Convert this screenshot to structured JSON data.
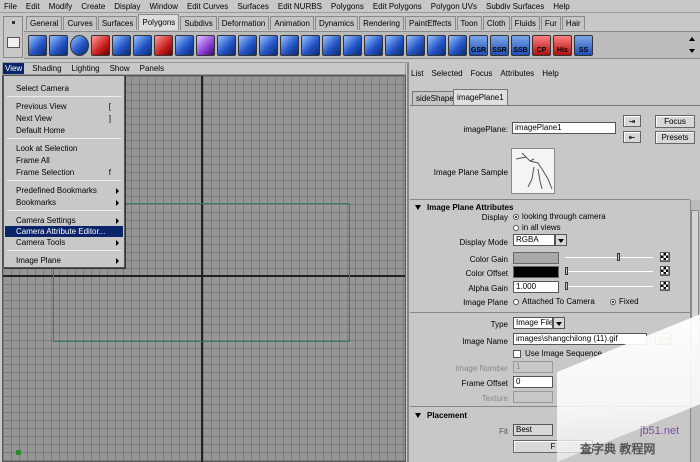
{
  "menubar": [
    "File",
    "Edit",
    "Modify",
    "Create",
    "Display",
    "Window",
    "Edit Curves",
    "Surfaces",
    "Edit NURBS",
    "Polygons",
    "Edit Polygons",
    "Polygon UVs",
    "Subdiv Surfaces",
    "Help"
  ],
  "shelf_tabs": [
    "General",
    "Curves",
    "Surfaces",
    "Polygons",
    "Subdivs",
    "Deformation",
    "Animation",
    "Dynamics",
    "Rendering",
    "PaintEffects",
    "Toon",
    "Cloth",
    "Fluids",
    "Fur",
    "Hair"
  ],
  "shelf_active_tab": "Polygons",
  "shelf_labels": [
    "GSR",
    "SSR",
    "SSB",
    "CP",
    "His",
    "SS"
  ],
  "viewport_menu": [
    "View",
    "Shading",
    "Lighting",
    "Show",
    "Panels"
  ],
  "view_menu": {
    "items": [
      {
        "label": "Select Camera",
        "shortcut": "",
        "submenu": false
      },
      {
        "label": "Previous View",
        "shortcut": "[",
        "submenu": false
      },
      {
        "label": "Next View",
        "shortcut": "]",
        "submenu": false
      },
      {
        "label": "Default Home",
        "shortcut": "",
        "submenu": false
      },
      {
        "label": "Look at Selection",
        "shortcut": "",
        "submenu": false
      },
      {
        "label": "Frame All",
        "shortcut": "",
        "submenu": false
      },
      {
        "label": "Frame Selection",
        "shortcut": "f",
        "submenu": false
      },
      {
        "label": "Predefined Bookmarks",
        "shortcut": "",
        "submenu": true
      },
      {
        "label": "Bookmarks",
        "shortcut": "",
        "submenu": true
      },
      {
        "label": "Camera Settings",
        "shortcut": "",
        "submenu": true
      },
      {
        "label": "Camera Attribute Editor...",
        "shortcut": "",
        "submenu": false
      },
      {
        "label": "Camera Tools",
        "shortcut": "",
        "submenu": true
      },
      {
        "label": "Image Plane",
        "shortcut": "",
        "submenu": true
      }
    ],
    "highlighted": "Camera Attribute Editor..."
  },
  "attr_editor": {
    "menu": [
      "List",
      "Selected",
      "Focus",
      "Attributes",
      "Help"
    ],
    "tabs": [
      "sideShape",
      "imagePlane1"
    ],
    "active_tab": "imagePlane1",
    "node_label": "imagePlane:",
    "node_value": "imagePlane1",
    "focus_button": "Focus",
    "presets_button": "Presets",
    "sample_label": "Image Plane Sample",
    "section1_title": "Image Plane Attributes",
    "display_label": "Display",
    "display_opt1": "looking through camera",
    "display_opt2": "in all views",
    "display_mode_label": "Display Mode",
    "display_mode_value": "RGBA",
    "color_gain_label": "Color Gain",
    "color_offset_label": "Color Offset",
    "alpha_gain_label": "Alpha Gain",
    "alpha_gain_value": "1.000",
    "image_plane_label": "Image Plane",
    "image_plane_opt1": "Attached To Camera",
    "image_plane_opt2": "Fixed",
    "type_label": "Type",
    "type_value": "Image File",
    "image_name_label": "Image Name",
    "image_name_value": "images\\shangchilong (11).gif",
    "use_sequence_label": "Use Image Sequence",
    "image_number_label": "Image Number",
    "image_number_value": "1",
    "frame_offset_label": "Frame Offset",
    "frame_offset_value": "0",
    "texture_label": "Texture",
    "section2_title": "Placement",
    "fit_label": "Fit",
    "fit_value": "Best",
    "bottom_button": "F"
  },
  "watermark": {
    "line1": "查字典 教程网",
    "url": "jb51.net"
  },
  "colors": {
    "highlight": "#0a246a",
    "viewport_bg": "#969696",
    "gate_line": "#2f7f56"
  }
}
